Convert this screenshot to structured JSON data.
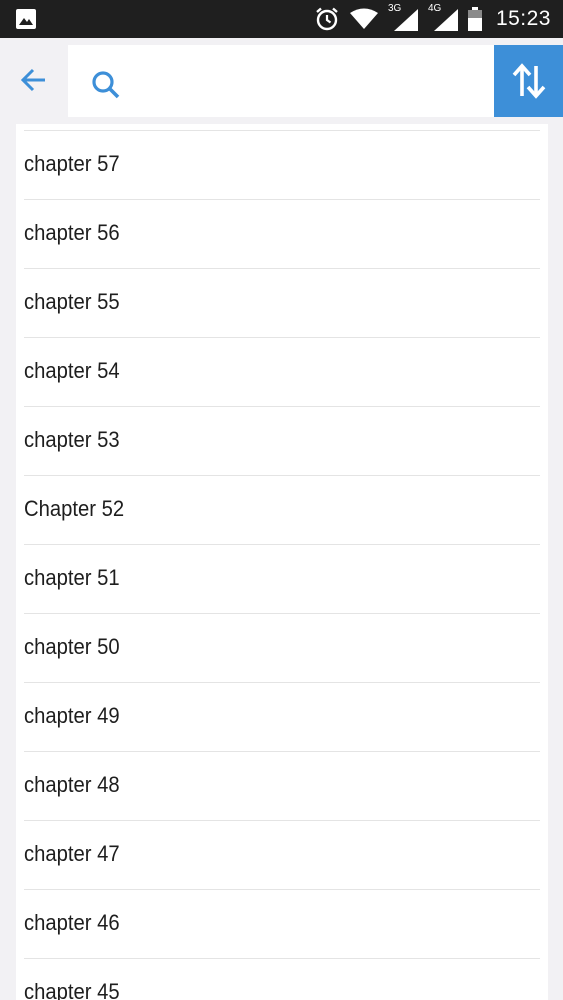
{
  "status_bar": {
    "network_left": "3G",
    "network_right": "4G",
    "time": "15:23",
    "icons": [
      "image-icon",
      "alarm-icon",
      "wifi-icon",
      "signal-icon",
      "signal-icon",
      "battery-icon"
    ]
  },
  "header": {
    "back_icon": "arrow-left-icon",
    "search": {
      "icon": "search-icon",
      "value": "",
      "placeholder": ""
    },
    "sort_icon": "sort-arrows-icon"
  },
  "colors": {
    "accent": "#3d8fd8",
    "background": "#f2f1f4",
    "status_bar": "#1f1f1f"
  },
  "chapters": [
    "chapter 57",
    "chapter 56",
    "chapter 55",
    "chapter 54",
    "chapter 53",
    "Chapter 52",
    "chapter 51",
    "chapter 50",
    "chapter 49",
    "chapter 48",
    "chapter 47",
    "chapter 46",
    "chapter 45"
  ]
}
